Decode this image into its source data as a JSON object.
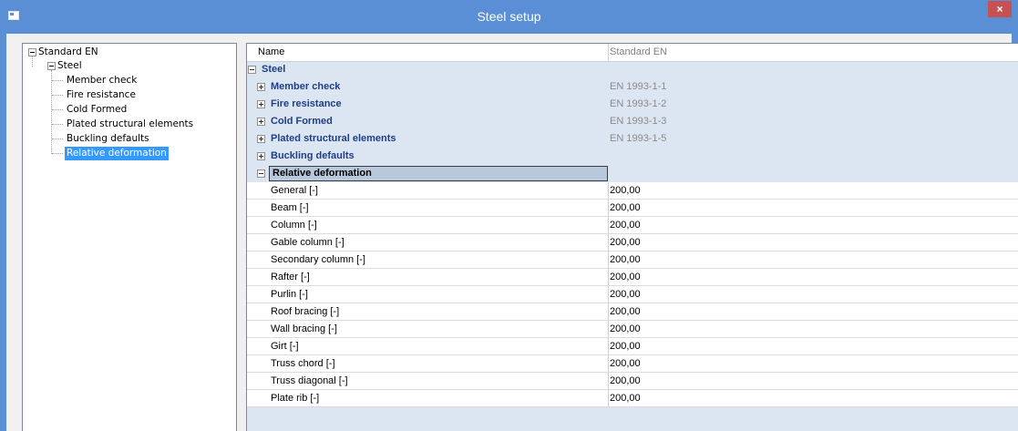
{
  "window": {
    "title": "Steel setup",
    "close_glyph": "×",
    "icon": "window-icon"
  },
  "tree": {
    "root": "Standard EN",
    "steel": "Steel",
    "items": [
      {
        "label": "Member check"
      },
      {
        "label": "Fire resistance"
      },
      {
        "label": "Cold Formed"
      },
      {
        "label": "Plated structural elements"
      },
      {
        "label": "Buckling defaults"
      },
      {
        "label": "Relative deformation",
        "selected": true
      }
    ]
  },
  "grid": {
    "header_name": "Name",
    "header_value": "Standard EN",
    "steel_group": "Steel",
    "groups": [
      {
        "label": "Member check",
        "value": "EN 1993-1-1"
      },
      {
        "label": "Fire resistance",
        "value": "EN 1993-1-2"
      },
      {
        "label": "Cold Formed",
        "value": "EN 1993-1-3"
      },
      {
        "label": "Plated structural elements",
        "value": "EN 1993-1-5"
      },
      {
        "label": "Buckling defaults",
        "value": ""
      }
    ],
    "relative_deformation": "Relative deformation",
    "rows": [
      {
        "label": "General [-]",
        "value": "200,00"
      },
      {
        "label": "Beam [-]",
        "value": "200,00"
      },
      {
        "label": "Column [-]",
        "value": "200,00"
      },
      {
        "label": "Gable column [-]",
        "value": "200,00"
      },
      {
        "label": "Secondary column [-]",
        "value": "200,00"
      },
      {
        "label": "Rafter [-]",
        "value": "200,00"
      },
      {
        "label": "Purlin [-]",
        "value": "200,00"
      },
      {
        "label": "Roof bracing [-]",
        "value": "200,00"
      },
      {
        "label": "Wall bracing [-]",
        "value": "200,00"
      },
      {
        "label": "Girt [-]",
        "value": "200,00"
      },
      {
        "label": "Truss chord [-]",
        "value": "200,00"
      },
      {
        "label": "Truss diagonal [-]",
        "value": "200,00"
      },
      {
        "label": "Plate rib [-]",
        "value": "200,00"
      }
    ]
  },
  "colors": {
    "title_bar": "#5a8fd6",
    "close_button": "#c75050",
    "selection": "#3399ff",
    "group_text": "#1f3e84",
    "grid_background": "#dce6f2"
  }
}
